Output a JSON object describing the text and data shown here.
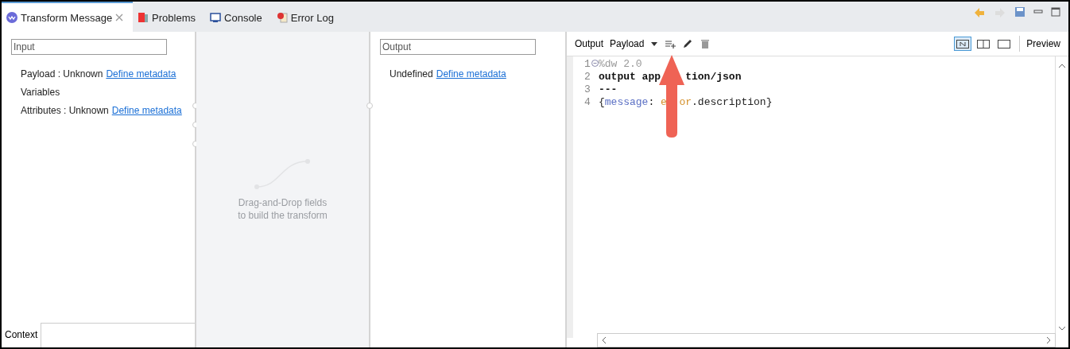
{
  "tabs": [
    {
      "label": "Transform Message",
      "selected": true,
      "closable": true
    },
    {
      "label": "Problems",
      "selected": false,
      "closable": false
    },
    {
      "label": "Console",
      "selected": false,
      "closable": false
    },
    {
      "label": "Error Log",
      "selected": false,
      "closable": false
    }
  ],
  "input": {
    "placeholder": "Input",
    "items": [
      {
        "label": "Payload : Unknown",
        "link": "Define metadata"
      },
      {
        "label": "Variables"
      },
      {
        "label": "Attributes : Unknown",
        "link": "Define metadata"
      }
    ],
    "bottom_tab": "Context"
  },
  "mapping": {
    "hint": [
      "Drag-and-Drop fields",
      "to build the transform"
    ]
  },
  "output": {
    "placeholder": "Output",
    "items": [
      {
        "label": "Undefined",
        "link": "Define metadata"
      }
    ]
  },
  "editor": {
    "toolbar": {
      "label": "Output",
      "target": "Payload",
      "preview": "Preview",
      "view_modes": [
        {
          "kind": "both",
          "selected": true
        },
        {
          "kind": "split",
          "selected": false
        },
        {
          "kind": "single",
          "selected": false
        }
      ]
    },
    "lines": [
      {
        "number": "1",
        "fold": true,
        "tokens": [
          {
            "kind": "directive",
            "text": "%dw 2.0"
          }
        ]
      },
      {
        "number": "2",
        "fold": false,
        "tokens": [
          {
            "kind": "keyword",
            "text": "output app"
          },
          {
            "kind": "covered_wide"
          },
          {
            "kind": "keyword",
            "text": "tion/json"
          }
        ]
      },
      {
        "number": "3",
        "fold": false,
        "tokens": [
          {
            "kind": "keyword",
            "text": "---"
          }
        ]
      },
      {
        "number": "4",
        "fold": false,
        "tokens": [
          {
            "kind": "plain",
            "text": "{"
          },
          {
            "kind": "field",
            "text": "message"
          },
          {
            "kind": "plain",
            "text": ": "
          },
          {
            "kind": "variable",
            "text": "e"
          },
          {
            "kind": "covered_narrow"
          },
          {
            "kind": "variable",
            "text": "or"
          },
          {
            "kind": "plain",
            "text": ".description}"
          }
        ]
      }
    ]
  }
}
